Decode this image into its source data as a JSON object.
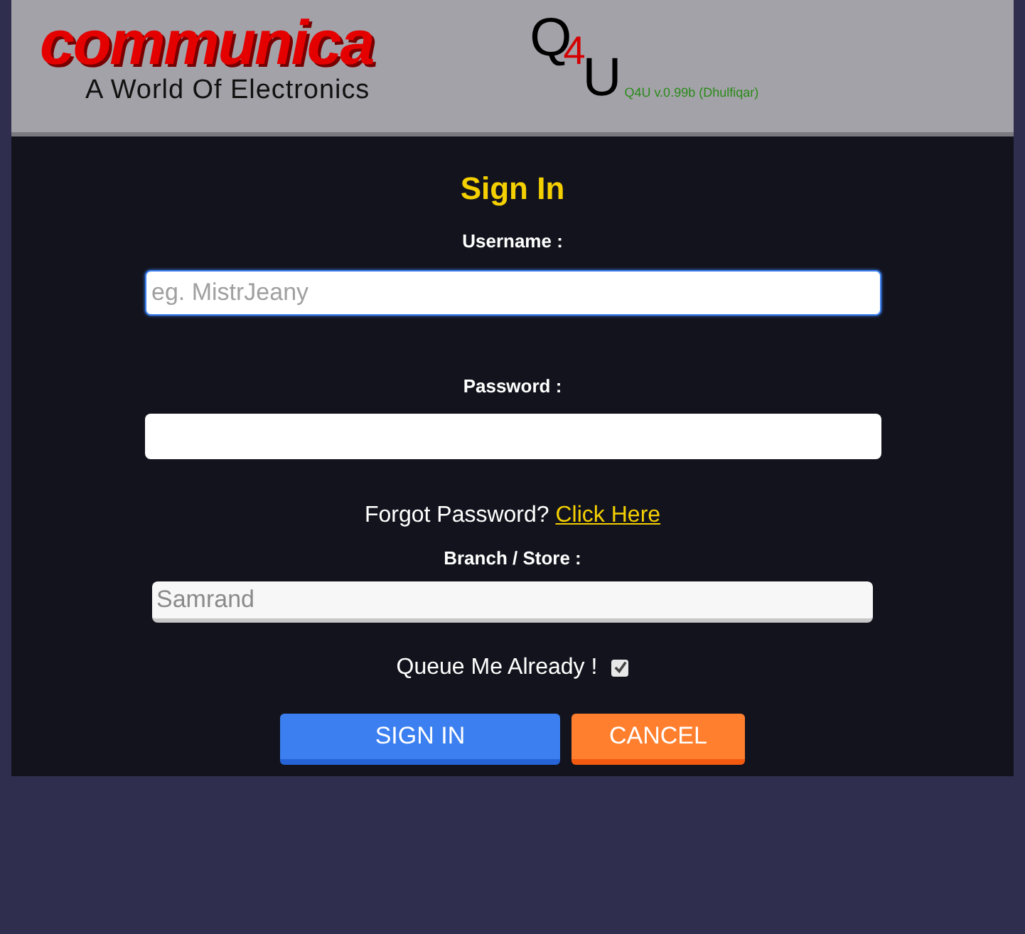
{
  "header": {
    "brand": "communica",
    "tagline": "A World Of Electronics",
    "app_logo": {
      "letters": [
        "Q",
        "4",
        "U"
      ]
    },
    "version": "Q4U v.0.99b (Dhulfiqar)"
  },
  "form": {
    "title": "Sign In",
    "username": {
      "label": "Username :",
      "placeholder": "eg. MistrJeany",
      "focused": true
    },
    "password": {
      "label": "Password :"
    },
    "forgot": {
      "text": "Forgot Password?",
      "link": "Click Here"
    },
    "branch": {
      "label": "Branch / Store :",
      "value": "Samrand",
      "disabled": true
    },
    "queue": {
      "label": "Queue Me Already !",
      "checked": true
    },
    "buttons": [
      {
        "label": "SIGN IN",
        "kind": "primary"
      },
      {
        "label": "CANCEL",
        "kind": "cancel"
      }
    ]
  }
}
